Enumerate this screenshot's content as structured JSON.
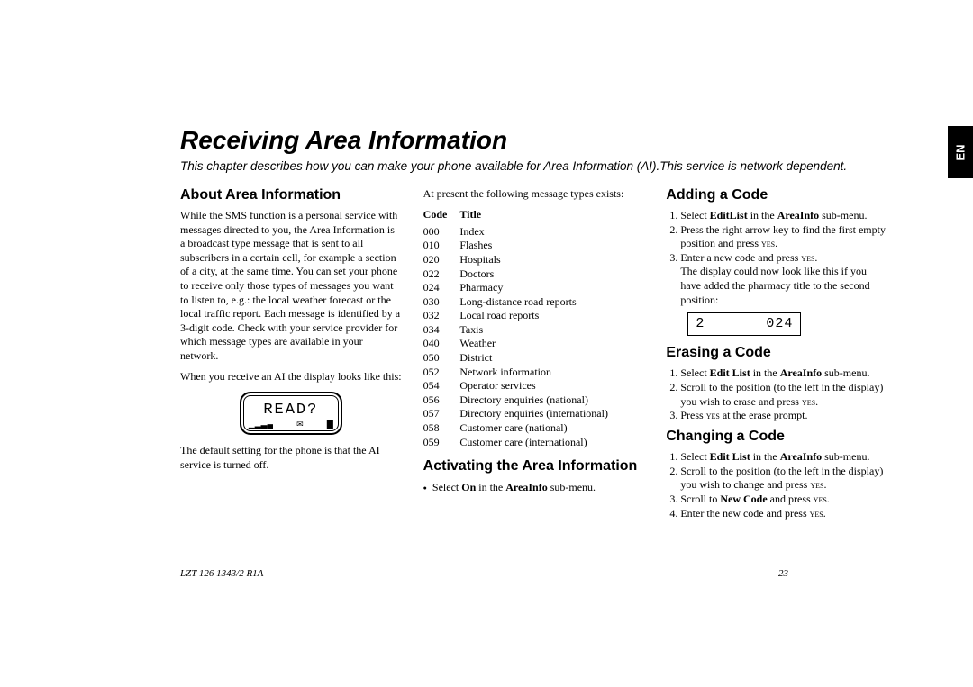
{
  "lang_tab": "EN",
  "title": "Receiving Area Information",
  "subtitle": "This chapter describes how you can make your phone available for Area Information (AI).This service is network dependent.",
  "col1": {
    "h_about": "About Area Information",
    "p1": "While the SMS function is a personal service with messages directed to you, the Area Information is a broadcast type message that is sent to all subscribers in a certain cell, for example a section of a city, at the same time. You can set your phone to receive only those types of messages you want to listen to, e.g.: the local weather forecast or the local traffic report. Each message is identified by a 3-digit code. Check with your service provider for which message types are available in your network.",
    "p2": "When you receive an AI the display looks like this:",
    "lcd_read": "READ?",
    "p3": "The default setting for the phone is that the AI service is turned off."
  },
  "col2": {
    "intro": "At present the following message types exists:",
    "th_code": "Code",
    "th_title": "Title",
    "rows": [
      {
        "c": "000",
        "t": "Index"
      },
      {
        "c": "010",
        "t": "Flashes"
      },
      {
        "c": "020",
        "t": "Hospitals"
      },
      {
        "c": "022",
        "t": "Doctors"
      },
      {
        "c": "024",
        "t": "Pharmacy"
      },
      {
        "c": "030",
        "t": "Long-distance road reports"
      },
      {
        "c": "032",
        "t": "Local road reports"
      },
      {
        "c": "034",
        "t": "Taxis"
      },
      {
        "c": "040",
        "t": "Weather"
      },
      {
        "c": "050",
        "t": "District"
      },
      {
        "c": "052",
        "t": "Network information"
      },
      {
        "c": "054",
        "t": "Operator services"
      },
      {
        "c": "056",
        "t": "Directory enquiries (national)"
      },
      {
        "c": "057",
        "t": "Directory enquiries (international)"
      },
      {
        "c": "058",
        "t": "Customer care (national)"
      },
      {
        "c": "059",
        "t": "Customer care (international)"
      }
    ],
    "h_activate": "Activating the Area Information",
    "bullet_activate_pre": "Select ",
    "bullet_activate_on": "On",
    "bullet_activate_mid": " in the ",
    "bullet_activate_menu": "AreaInfo",
    "bullet_activate_post": " sub-menu."
  },
  "col3": {
    "h_add": "Adding a Code",
    "add_1_pre": "Select ",
    "add_1_b1": "EditList",
    "add_1_mid": " in the ",
    "add_1_b2": "AreaInfo",
    "add_1_post": " sub-menu.",
    "add_2_pre": "Press the right arrow key to find the first empty position and press ",
    "add_2_yes": "yes",
    "add_2_post": ".",
    "add_3a_pre": "Enter a new code and press ",
    "add_3a_yes": "yes",
    "add_3a_post": ".",
    "add_3b": "The display could now look like this if you have added the pharmacy title to the second position:",
    "lcd_left": "2",
    "lcd_right": "024",
    "h_erase": "Erasing a Code",
    "er_1_pre": "Select ",
    "er_1_b1": "Edit List",
    "er_1_mid": " in the ",
    "er_1_b2": "AreaInfo",
    "er_1_post": " sub-menu.",
    "er_2_pre": "Scroll to the position (to the left in the display) you wish to erase and press ",
    "er_2_yes": "yes",
    "er_2_post": ".",
    "er_3_pre": "Press ",
    "er_3_yes": "yes",
    "er_3_post": " at the erase prompt.",
    "h_change": "Changing a Code",
    "ch_1_pre": "Select ",
    "ch_1_b1": "Edit List",
    "ch_1_mid": " in the ",
    "ch_1_b2": "AreaInfo",
    "ch_1_post": " sub-menu.",
    "ch_2_pre": "Scroll to the position (to the left in the display) you wish to change and press ",
    "ch_2_yes": "yes",
    "ch_2_post": ".",
    "ch_3_pre": "Scroll to ",
    "ch_3_b": "New Code",
    "ch_3_mid": " and press ",
    "ch_3_yes": "yes",
    "ch_3_post": ".",
    "ch_4_pre": "Enter the new code and press ",
    "ch_4_yes": "yes",
    "ch_4_post": "."
  },
  "footer_left": "LZT 126 1343/2 R1A",
  "footer_right": "23"
}
